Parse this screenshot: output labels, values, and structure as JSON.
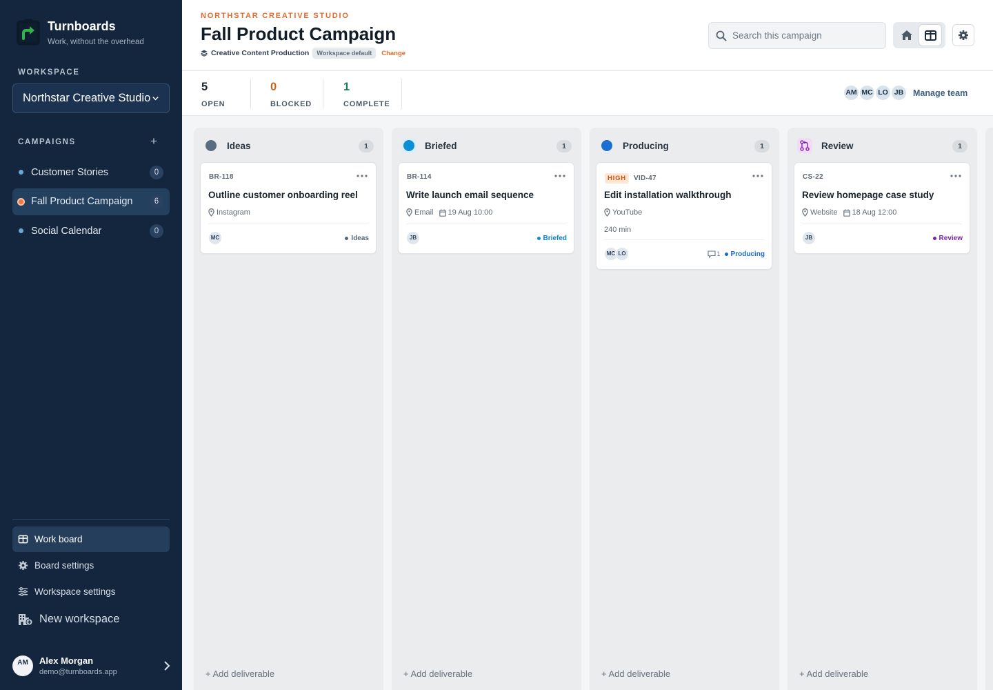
{
  "brand": {
    "name": "Turnboards",
    "tagline": "Work, without the overhead"
  },
  "sidebar": {
    "workspace_label": "WORKSPACE",
    "workspace_selected": "Northstar Creative Studio",
    "campaigns_label": "CAMPAIGNS",
    "campaigns": [
      {
        "label": "Customer Stories",
        "count": "0",
        "dot_color": "#6aa6d6",
        "active": false
      },
      {
        "label": "Fall Product Campaign",
        "count": "6",
        "dot_color": "#f0764a",
        "active": true
      },
      {
        "label": "Social Calendar",
        "count": "0",
        "dot_color": "#6aa6d6",
        "active": false
      }
    ],
    "nav": {
      "work_board": "Work board",
      "board_settings": "Board settings",
      "workspace_settings": "Workspace settings",
      "new_workspace": "New workspace"
    },
    "user": {
      "initials": "AM",
      "name": "Alex Morgan",
      "email": "demo@turnboards.app"
    }
  },
  "header": {
    "org": "NORTHSTAR CREATIVE STUDIO",
    "title": "Fall Product Campaign",
    "process": "Creative Content Production",
    "process_badge": "Workspace default",
    "change": "Change",
    "search_placeholder": "Search this campaign"
  },
  "stats": {
    "open": {
      "value": "5",
      "label": "OPEN",
      "color": "#1b2530"
    },
    "blocked": {
      "value": "0",
      "label": "BLOCKED",
      "color": "#c4651c"
    },
    "complete": {
      "value": "1",
      "label": "COMPLETE",
      "color": "#1f7a5a"
    },
    "team": [
      "AM",
      "MC",
      "LO",
      "JB"
    ],
    "manage_team": "Manage team"
  },
  "board": {
    "add_label": "+ Add deliverable",
    "columns": [
      {
        "title": "Ideas",
        "count": "1",
        "card": {
          "id": "BR-118",
          "priority": "",
          "title": "Outline customer onboarding reel",
          "channel": "Instagram",
          "due": "",
          "estimate": "",
          "assignees": [
            "MC"
          ],
          "comments": "",
          "status": "Ideas",
          "status_color": "#55697d"
        }
      },
      {
        "title": "Briefed",
        "count": "1",
        "card": {
          "id": "BR-114",
          "priority": "",
          "title": "Write launch email sequence",
          "channel": "Email",
          "due": "19 Aug 10:00",
          "estimate": "",
          "assignees": [
            "JB"
          ],
          "comments": "",
          "status": "Briefed",
          "status_color": "#0b7fc7"
        }
      },
      {
        "title": "Producing",
        "count": "1",
        "card": {
          "id": "VID-47",
          "priority": "HIGH",
          "title": "Edit installation walkthrough",
          "channel": "YouTube",
          "due": "",
          "estimate": "240 min",
          "assignees": [
            "MC",
            "LO"
          ],
          "comments": "1",
          "status": "Producing",
          "status_color": "#1968c9"
        }
      },
      {
        "title": "Review",
        "count": "1",
        "card": {
          "id": "CS-22",
          "priority": "",
          "title": "Review homepage case study",
          "channel": "Website",
          "due": "18 Aug 12:00",
          "estimate": "",
          "assignees": [
            "JB"
          ],
          "comments": "",
          "status": "Review",
          "status_color": "#7b22a8"
        }
      }
    ]
  }
}
